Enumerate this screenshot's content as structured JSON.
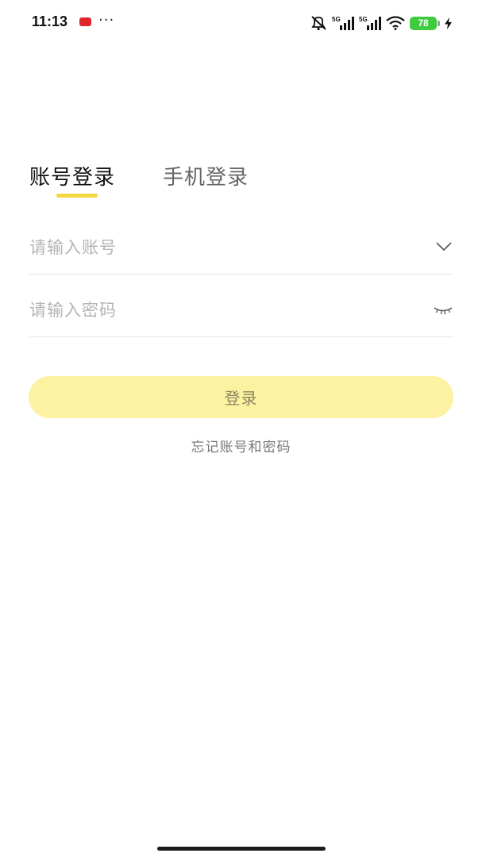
{
  "status_bar": {
    "time": "11:13",
    "more": "···",
    "signal_1": "5G",
    "signal_2": "5G",
    "battery": "78"
  },
  "tabs": [
    {
      "label": "账号登录",
      "active": true
    },
    {
      "label": "手机登录",
      "active": false
    }
  ],
  "form": {
    "account": {
      "value": "",
      "placeholder": "请输入账号"
    },
    "password": {
      "value": "",
      "placeholder": "请输入密码"
    }
  },
  "login_button": {
    "label": "登录"
  },
  "forgot_link": {
    "label": "忘记账号和密码"
  },
  "colors": {
    "accent": "#f5d840",
    "button_bg": "#fcf2a2",
    "battery": "#3ecb3e"
  },
  "icons": [
    "mute-icon",
    "signal-icon",
    "wifi-icon",
    "battery-icon",
    "charging-icon",
    "chevron-down-icon",
    "eye-closed-icon"
  ]
}
